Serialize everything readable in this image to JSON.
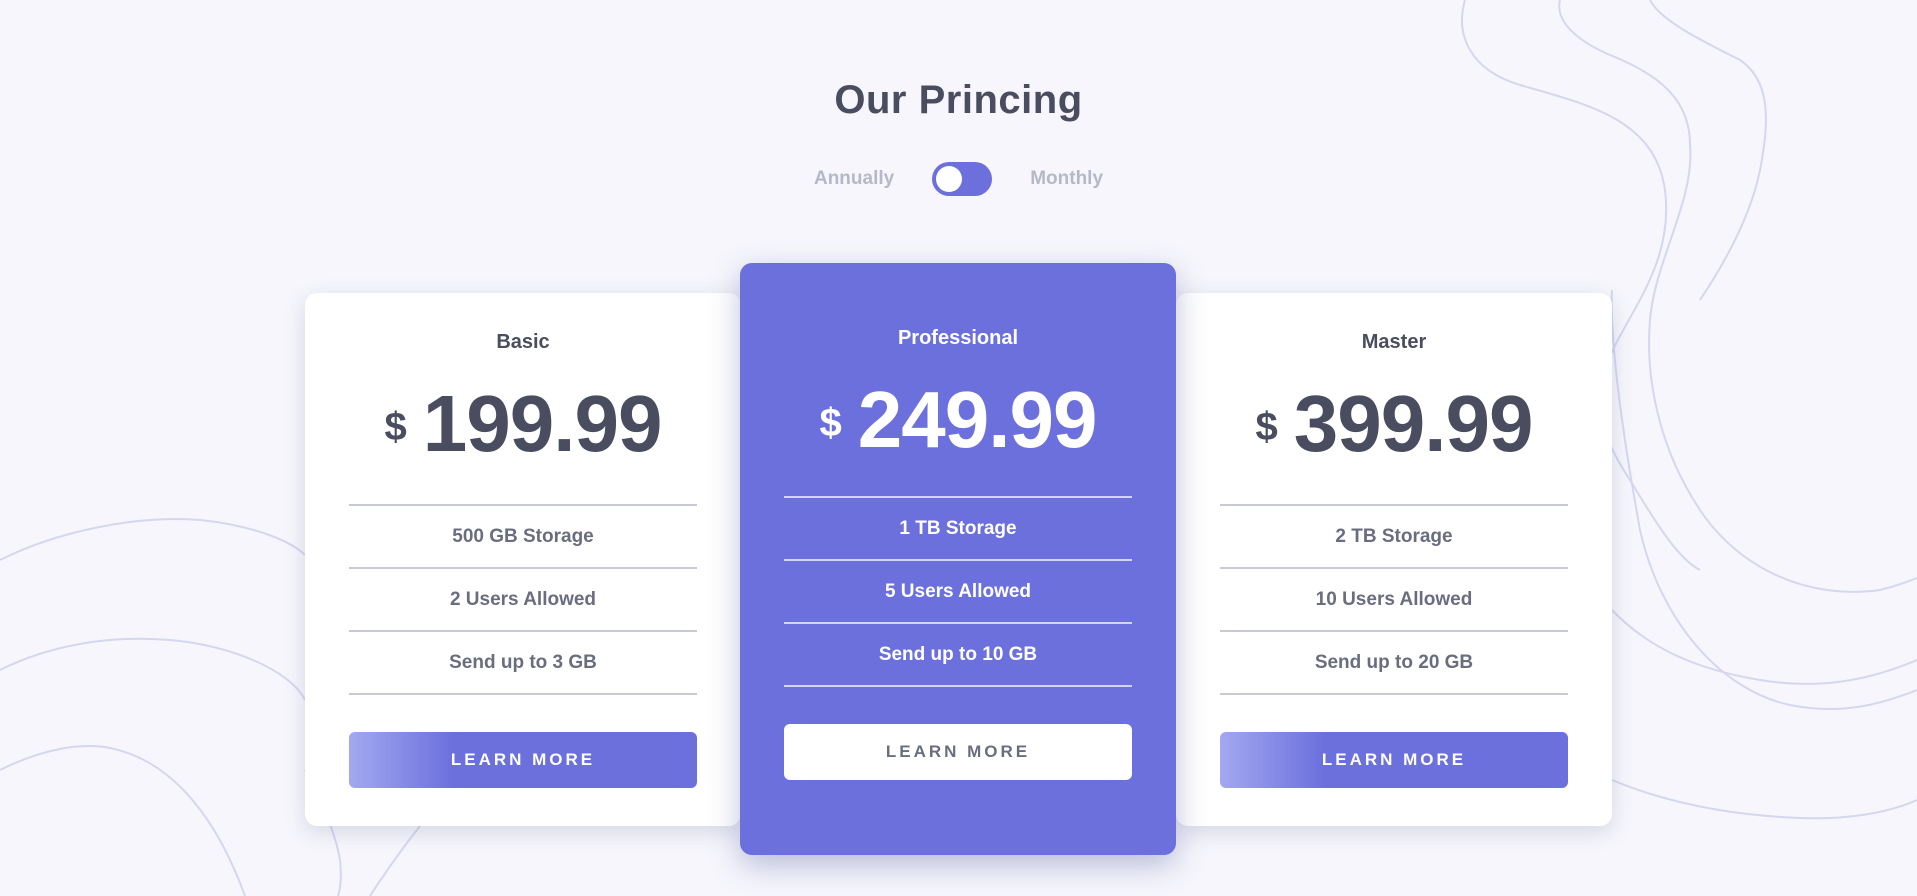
{
  "page": {
    "title": "Our Princing"
  },
  "billing": {
    "annually_label": "Annually",
    "monthly_label": "Monthly"
  },
  "plans": [
    {
      "name": "Basic",
      "currency": "$",
      "price": "199.99",
      "features": [
        "500 GB Storage",
        "2 Users Allowed",
        "Send up to 3 GB"
      ],
      "cta": "LEARN MORE"
    },
    {
      "name": "Professional",
      "currency": "$",
      "price": "249.99",
      "features": [
        "1 TB Storage",
        "5 Users Allowed",
        "Send up to 10 GB"
      ],
      "cta": "LEARN MORE"
    },
    {
      "name": "Master",
      "currency": "$",
      "price": "399.99",
      "features": [
        "2 TB Storage",
        "10 Users Allowed",
        "Send up to 20 GB"
      ],
      "cta": "LEARN MORE"
    }
  ],
  "colors": {
    "background": "#F6F6FC",
    "accent": "#6B70DD",
    "text_primary": "#4A4D60",
    "text_muted": "#B6B8C8"
  }
}
